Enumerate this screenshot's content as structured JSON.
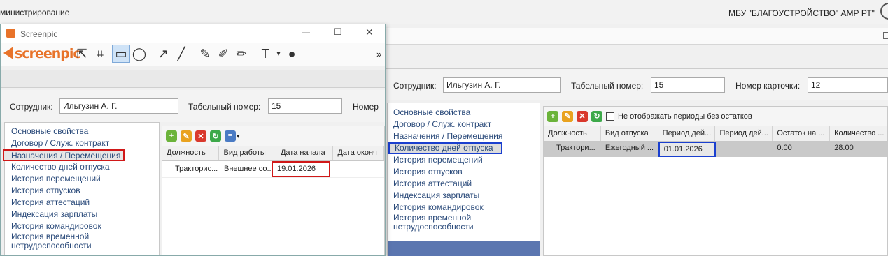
{
  "topbar": {
    "left_title": "министрирование",
    "right_title": "МБУ \"БЛАГОУСТРОЙСТВО\" АМР РТ\""
  },
  "screenpic": {
    "title": "Screenpic",
    "logo_text": "screenpic",
    "more": "»",
    "window_controls": {
      "minimize": "—",
      "maximize": "☐",
      "close": "✕"
    },
    "tools": [
      "select",
      "crop",
      "rectangle",
      "ellipse",
      "arrow",
      "line",
      "pen",
      "marker",
      "highlighter",
      "text",
      "blur"
    ]
  },
  "left_form": {
    "employee_label": "Сотрудник:",
    "employee_value": "Ильгузин А. Г.",
    "tabnum_label": "Табельный номер:",
    "tabnum_value": "15",
    "card_label": "Номер",
    "nav": [
      "Основные свойства",
      "Договор / Служ. контракт",
      "Назначения / Перемещения",
      "Количество дней отпуска",
      "История перемещений",
      "История отпусков",
      "История аттестаций",
      "Индексация зарплаты",
      "История командировок",
      "История временной нетрудоспособности"
    ],
    "table": {
      "headers": [
        "Должность",
        "Вид работы",
        "Дата начала",
        "Дата оконч"
      ],
      "rows": [
        [
          "Тракторис...",
          "Внешнее со...",
          "19.01.2026",
          ""
        ]
      ]
    }
  },
  "right_form": {
    "employee_label": "Сотрудник:",
    "employee_value": "Ильгузин А. Г.",
    "tabnum_label": "Табельный номер:",
    "tabnum_value": "15",
    "card_label": "Номер карточки:",
    "card_value": "12",
    "nav": [
      "Основные свойства",
      "Договор / Служ. контракт",
      "Назначения / Перемещения",
      "Количество дней отпуска",
      "История перемещений",
      "История отпусков",
      "История аттестаций",
      "Индексация зарплаты",
      "История командировок",
      "История временной нетрудоспособности"
    ],
    "checkbox_label": "Не отображать периоды без остатков",
    "table": {
      "headers": [
        "Должность",
        "Вид отпуска",
        "Период дей...",
        "Период дей...",
        "Остаток на ...",
        "Количество ..."
      ],
      "rows": [
        [
          "Трактори...",
          "Ежегодный ...",
          "01.01.2026",
          "",
          "0.00",
          "28.00"
        ]
      ]
    }
  },
  "colors": {
    "highlight_red": "#d01818",
    "highlight_blue": "#1a3fcf",
    "nav_blue_bar": "#5b76b0"
  }
}
